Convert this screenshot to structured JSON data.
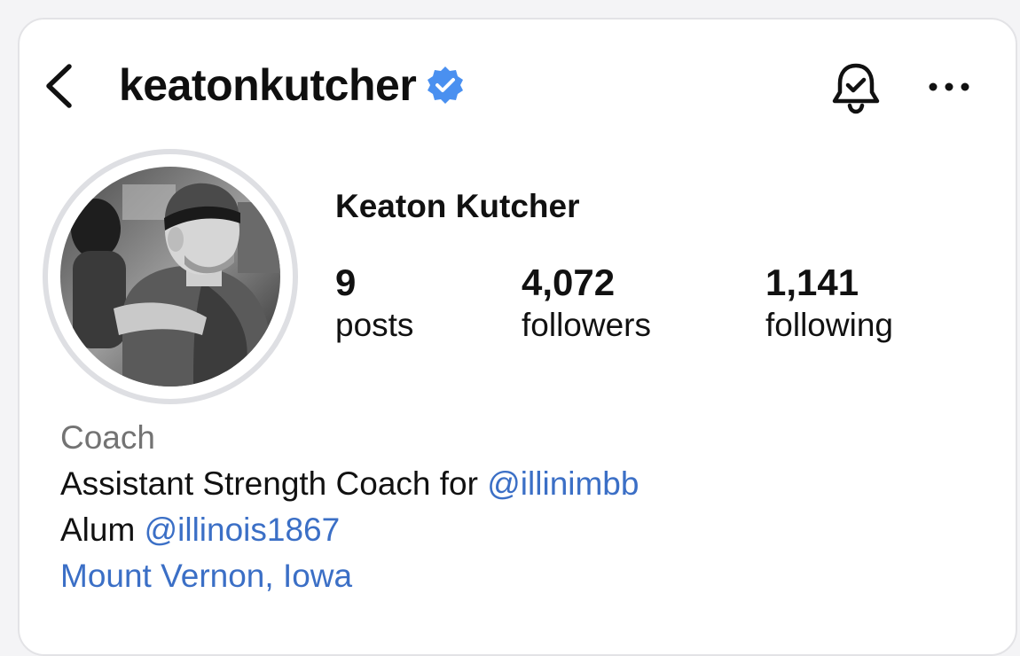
{
  "header": {
    "username": "keatonkutcher",
    "verified": true,
    "back_icon": "chevron-left-icon",
    "bell_icon": "bell-check-icon",
    "more_icon": "more-horizontal-icon"
  },
  "profile": {
    "display_name": "Keaton Kutcher",
    "stats": {
      "posts": {
        "count": "9",
        "label": "posts"
      },
      "followers": {
        "count": "4,072",
        "label": "followers"
      },
      "following": {
        "count": "1,141",
        "label": "following"
      }
    }
  },
  "bio": {
    "category": "Coach",
    "line1_text": "Assistant Strength Coach for ",
    "line1_mention": "@illinimbb",
    "line2_text": "Alum ",
    "line2_mention": "@illinois1867",
    "location": "Mount Vernon, Iowa"
  },
  "colors": {
    "link": "#3b6fc6",
    "verified": "#4a90f0",
    "category": "#737373",
    "ring": "#dedfe3"
  }
}
